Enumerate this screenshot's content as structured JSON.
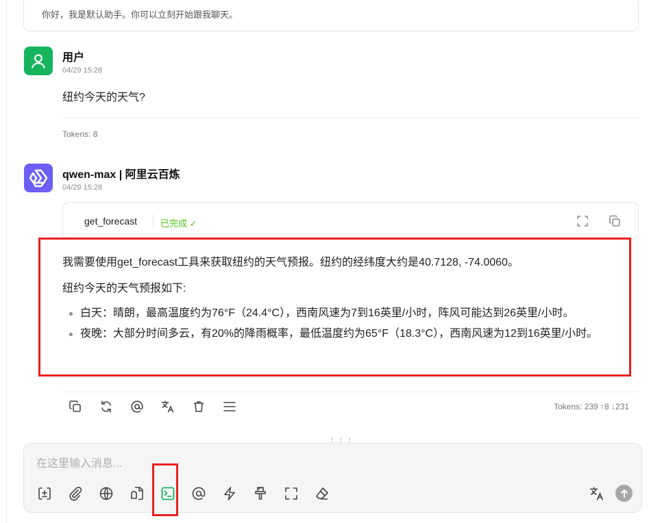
{
  "previous_message": {
    "text": "你好，我是默认助手。你可以立刻开始跟我聊天。"
  },
  "user_message": {
    "author": "用户",
    "time": "04/29 15:28",
    "text": "纽约今天的天气?",
    "tokens": "Tokens: 8"
  },
  "assistant_message": {
    "author": "qwen-max | 阿里云百炼",
    "time": "04/29 15:28",
    "tool_call": {
      "name": "get_forecast",
      "status": "已完成 ✓"
    },
    "paragraphs": [
      "我需要使用get_forecast工具来获取纽约的天气预报。纽约的经纬度大约是40.7128, -74.0060。",
      "纽约今天的天气预报如下:"
    ],
    "bullets": [
      "白天：晴朗，最高温度约为76°F（24.4°C），西南风速为7到16英里/小时，阵风可能达到26英里/小时。",
      "夜晚：大部分时间多云，有20%的降雨概率，最低温度约为65°F（18.3°C），西南风速为12到16英里/小时。"
    ],
    "tokens": "Tokens: 239 ↑8 ↓231",
    "actions": [
      "copy-icon",
      "regenerate-icon",
      "mention-icon",
      "translate-icon",
      "delete-icon",
      "menu-icon"
    ]
  },
  "composer": {
    "placeholder": "在这里输入消息...",
    "value": "",
    "tools": [
      "add-context-icon",
      "attachment-icon",
      "web-search-icon",
      "knowledge-icon",
      "mcp-terminal-icon",
      "mention-model-icon",
      "quick-phrase-icon",
      "clear-style-icon",
      "fullscreen-icon",
      "clear-icon"
    ]
  },
  "colors": {
    "user_avatar": "#16b45c",
    "bot_avatar": "#6c5ff6",
    "status_done": "#52c41a",
    "highlight": "#e8201e",
    "mcp_icon": "#16b45c"
  }
}
